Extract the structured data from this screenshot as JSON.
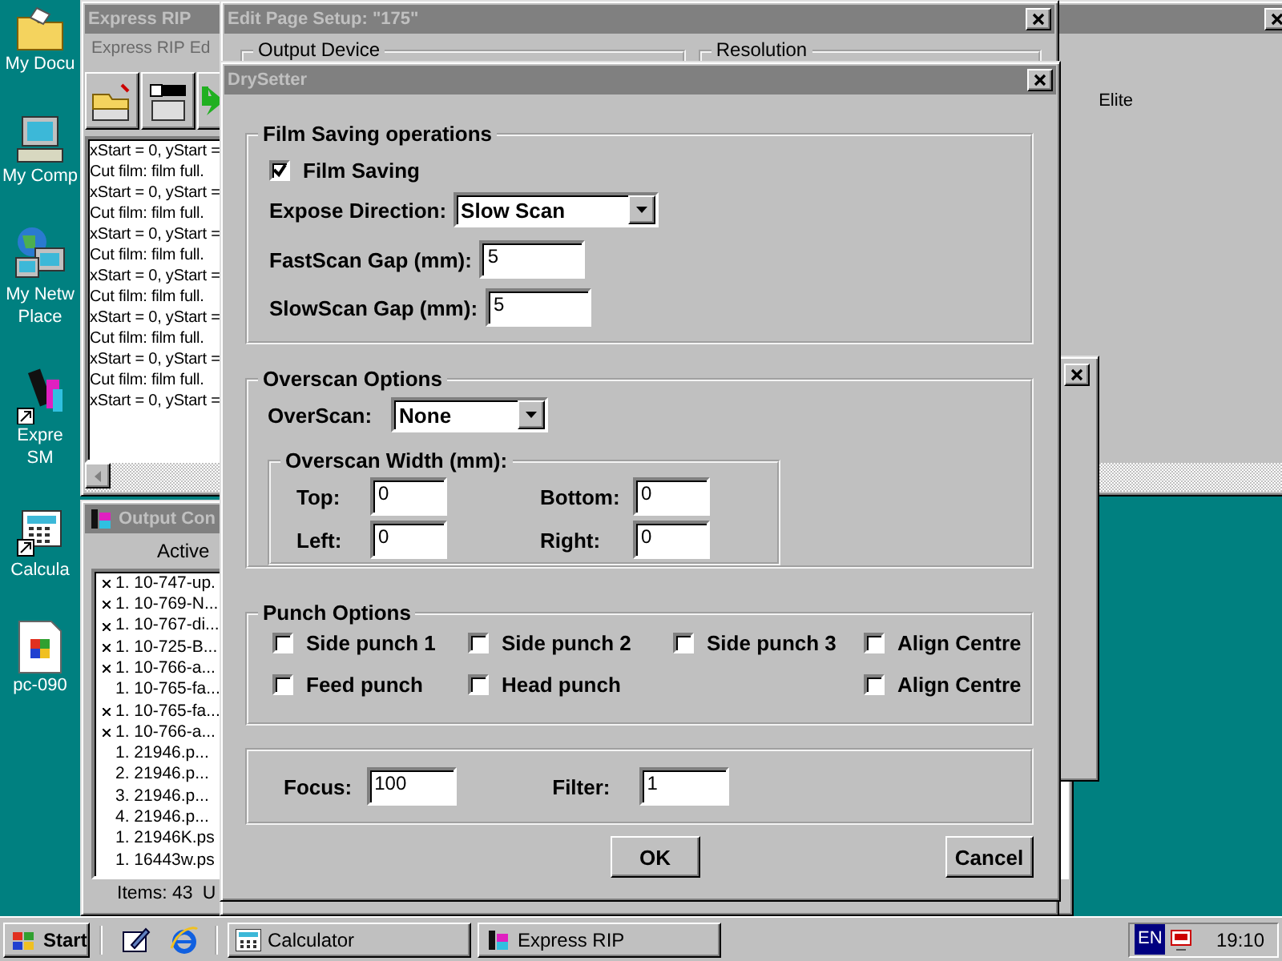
{
  "desktop_icons": [
    {
      "kind": "folder",
      "label": "My Docu"
    },
    {
      "kind": "computer",
      "label": "My Comp"
    },
    {
      "kind": "network",
      "label": "My Netw\nPlace"
    },
    {
      "kind": "app",
      "label": "Expre\nSM"
    },
    {
      "kind": "calculator",
      "label": "Calcula"
    },
    {
      "kind": "document",
      "label": "pc-090"
    }
  ],
  "express_rip": {
    "title": "Express RIP",
    "menu": [
      "Express RIP",
      "Ed"
    ],
    "log": [
      "xStart = 0, yStart =",
      "Cut film: film full.",
      "xStart = 0, yStart =",
      "Cut film: film full.",
      "xStart = 0, yStart =",
      "Cut film: film full.",
      "xStart = 0, yStart =",
      "Cut film: film full.",
      "xStart = 0, yStart =",
      "Cut film: film full.",
      "xStart = 0, yStart =",
      "Cut film: film full.",
      "xStart = 0, yStart ="
    ],
    "printer_text": "Elite"
  },
  "output_window": {
    "title": "Output Con",
    "header": "Active",
    "items": [
      {
        "marked": true,
        "text": "1. 10-747-up."
      },
      {
        "marked": true,
        "text": "1. 10-769-N..."
      },
      {
        "marked": true,
        "text": "1. 10-767-di..."
      },
      {
        "marked": true,
        "text": "1. 10-725-B..."
      },
      {
        "marked": true,
        "text": "1. 10-766-a..."
      },
      {
        "marked": false,
        "text": "1. 10-765-fa..."
      },
      {
        "marked": true,
        "text": "1. 10-765-fa..."
      },
      {
        "marked": true,
        "text": "1. 10-766-a..."
      },
      {
        "marked": false,
        "text": "1. 21946.p..."
      },
      {
        "marked": false,
        "text": "2. 21946.p..."
      },
      {
        "marked": false,
        "text": "3. 21946.p..."
      },
      {
        "marked": false,
        "text": "4. 21946.p..."
      },
      {
        "marked": false,
        "text": "1. 21946K.ps"
      },
      {
        "marked": false,
        "text": "1. 16443w.ps"
      }
    ],
    "status": [
      "Items: 43",
      "U"
    ]
  },
  "edit_page_setup": {
    "title": "Edit Page Setup: \"175\"",
    "groups": [
      "Output Device",
      "Resolution"
    ]
  },
  "drysetter": {
    "title": "DrySetter",
    "film_saving": {
      "title": "Film Saving operations",
      "film_saving": {
        "label": "Film Saving",
        "checked": true
      },
      "expose_direction": {
        "label": "Expose Direction:",
        "value": "Slow Scan"
      },
      "fastscan_gap": {
        "label": "FastScan Gap (mm):",
        "value": "5"
      },
      "slowscan_gap": {
        "label": "SlowScan Gap (mm):",
        "value": "5"
      }
    },
    "overscan": {
      "title": "Overscan Options",
      "overscan": {
        "label": "OverScan:",
        "value": "None"
      },
      "width": {
        "title": "Overscan Width (mm):",
        "fields": [
          {
            "label": "Top:",
            "value": "0"
          },
          {
            "label": "Bottom:",
            "value": "0"
          },
          {
            "label": "Left:",
            "value": "0"
          },
          {
            "label": "Right:",
            "value": "0"
          }
        ]
      }
    },
    "punch": {
      "title": "Punch Options",
      "rows": [
        [
          {
            "label": "Side punch 1",
            "checked": false
          },
          {
            "label": "Side punch 2",
            "checked": false
          },
          {
            "label": "Side punch 3",
            "checked": false
          },
          {
            "label": "Align Centre",
            "checked": false
          }
        ],
        [
          {
            "label": "Feed punch",
            "checked": false
          },
          {
            "label": "Head punch",
            "checked": false
          },
          "",
          {
            "label": "Align Centre",
            "checked": false
          }
        ]
      ]
    },
    "focus": {
      "label": "Focus:",
      "value": "100"
    },
    "filter": {
      "label": "Filter:",
      "value": "1"
    },
    "buttons": [
      "OK",
      "Cancel"
    ]
  },
  "taskbar": {
    "start": "Start",
    "tasks": [
      {
        "kind": "calculator",
        "label": "Calculator",
        "selected": false
      },
      {
        "kind": "app",
        "label": "Express RIP",
        "selected": false
      }
    ],
    "tray": {
      "language": "EN",
      "clock": "19:10"
    }
  }
}
